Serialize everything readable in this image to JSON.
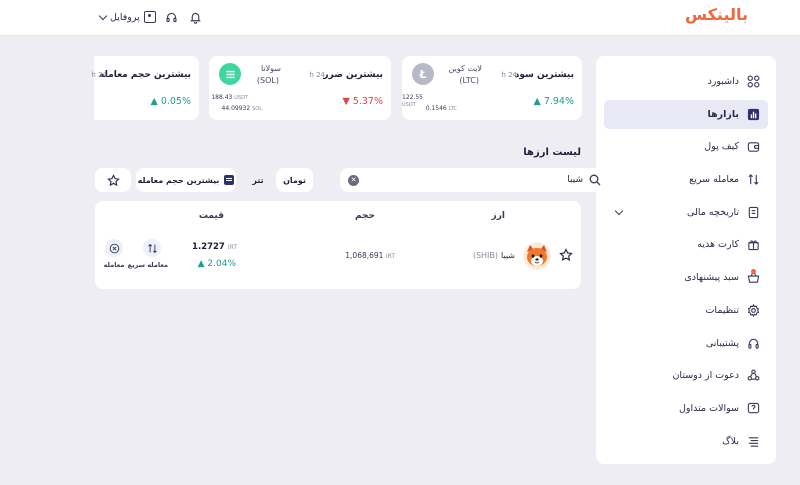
{
  "header": {
    "logo": "بالینکس",
    "profile_label": "پروفایل"
  },
  "sidebar": {
    "items": [
      {
        "label": "داشبورد"
      },
      {
        "label": "بازارها"
      },
      {
        "label": "کیف پول"
      },
      {
        "label": "معامله سریع"
      },
      {
        "label": "تاریخچه مالی"
      },
      {
        "label": "کارت هدیه"
      },
      {
        "label": "سبد پیشنهادی"
      },
      {
        "label": "تنظیمات"
      },
      {
        "label": "پشتیبانی"
      },
      {
        "label": "دعوت از دوستان"
      },
      {
        "label": "سوالات متداول"
      },
      {
        "label": "بلاگ"
      }
    ]
  },
  "cards": {
    "top_gainer": {
      "title": "بیشترین سود",
      "period": "24 h",
      "coin_name": "لایت کوین",
      "coin_symbol": "(LTC)",
      "change": "7.94%",
      "price_value": "122.55",
      "price_unit": "USDT",
      "amount_value": "0.1546",
      "amount_unit": "LTC"
    },
    "top_loser": {
      "title": "بیشترین ضرر",
      "period": "24 h",
      "coin_name": "سولانا",
      "coin_symbol": "(SOL)",
      "change": "5.37%",
      "price_value": "188.43",
      "price_unit": "USDT",
      "amount_value": "44.09932",
      "amount_unit": "SOL"
    },
    "top_volume": {
      "title": "بیشترین حجم معامله",
      "period": "24 h",
      "change": "0.05%"
    }
  },
  "markets": {
    "title": "لیست ارزها",
    "search_value": "شیبا",
    "chip_toman": "تومان",
    "chip_tether": "تتر",
    "sort_label": "بیشترین حجم معامله",
    "columns": {
      "coin": "ارز",
      "volume": "حجم",
      "price": "قیمت"
    },
    "rows": [
      {
        "name": "شیبا",
        "symbol": "(SHIB)",
        "volume": "1,068,691",
        "volume_unit": "IRT",
        "price": "1.2727",
        "price_unit": "IRT",
        "change": "2.04%",
        "quick_trade": "معامله سریع",
        "trade": "معامله"
      }
    ]
  }
}
